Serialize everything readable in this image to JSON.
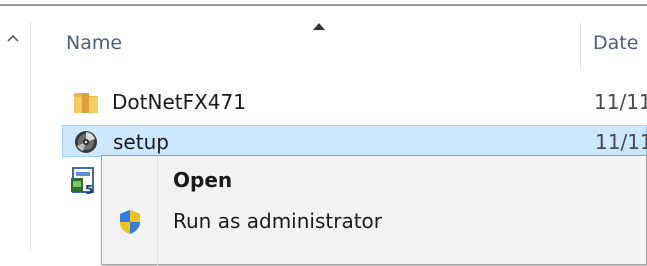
{
  "header": {
    "name_label": "Name",
    "date_label": "Date"
  },
  "files": [
    {
      "name": "DotNetFX471",
      "date": "11/11",
      "icon": "folder-icon",
      "selected": false
    },
    {
      "name": "setup",
      "date": "11/11",
      "icon": "setup-disc-icon",
      "selected": true
    }
  ],
  "context_menu": {
    "items": [
      {
        "label": "Open",
        "bold": true,
        "icon": ""
      },
      {
        "label": "Run as administrator",
        "bold": false,
        "icon": "uac-shield-icon"
      }
    ]
  },
  "colors": {
    "selection_bg": "#cce8ff",
    "selection_border": "#99d1ff",
    "menu_bg": "#f2f2f2",
    "header_text": "#4c607a"
  }
}
